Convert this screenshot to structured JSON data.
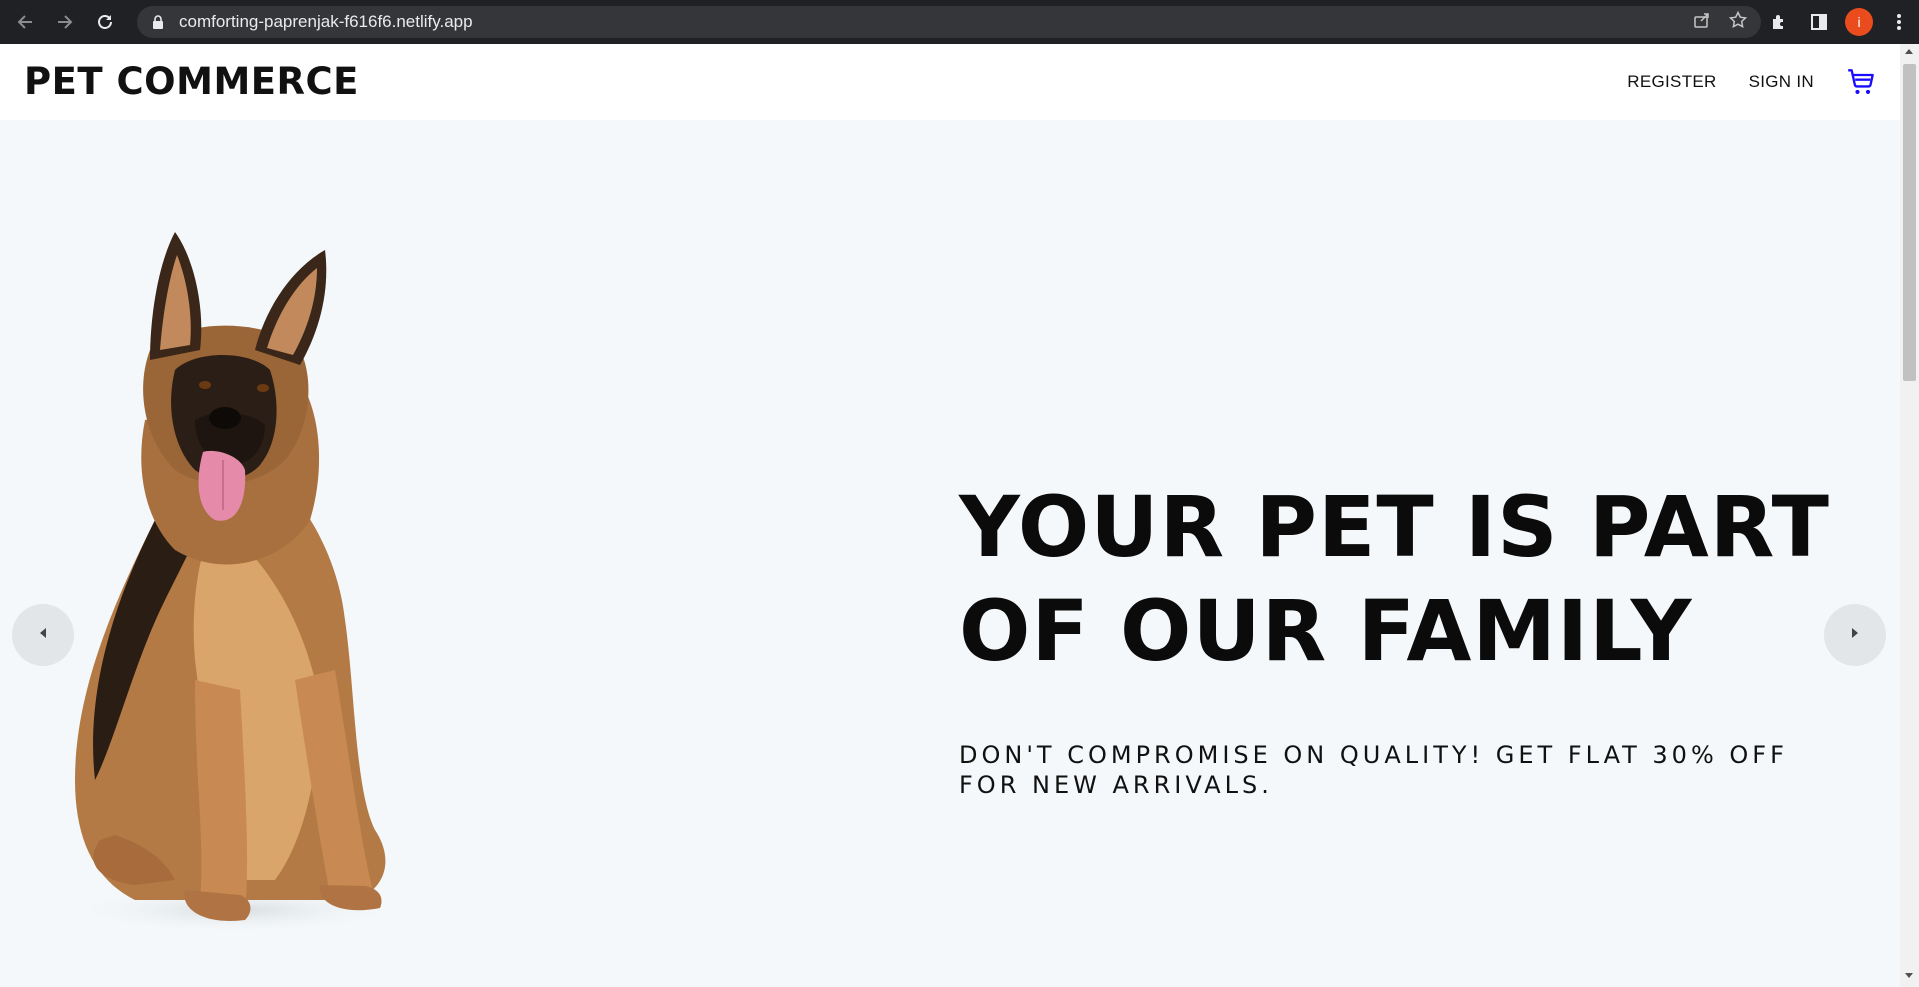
{
  "browser": {
    "url": "comforting-paprenjak-f616f6.netlify.app",
    "profile_initial": "i",
    "icons": [
      "back-icon",
      "forward-icon",
      "reload-icon",
      "lock-icon",
      "share-icon",
      "star-icon",
      "extensions-icon",
      "side-panel-icon",
      "menu-icon"
    ]
  },
  "site": {
    "logo": "PET COMMERCE",
    "nav": {
      "register": "REGISTER",
      "sign_in": "SIGN IN",
      "cart_icon": "cart-icon"
    },
    "colors": {
      "accent": "#1a0dff",
      "background": "#f4f8fa"
    }
  },
  "hero": {
    "headline": "YOUR PET IS PART OF OUR FAMILY",
    "subline": "DON'T COMPROMISE ON QUALITY! GET FLAT 30% OFF FOR NEW ARRIVALS.",
    "image": "german-shepherd-dog",
    "prev_icon": "chevron-left-icon",
    "next_icon": "chevron-right-icon"
  }
}
